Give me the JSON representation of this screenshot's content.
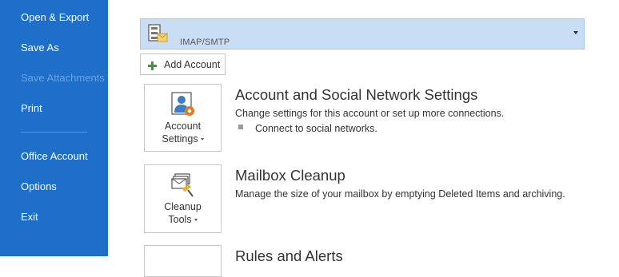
{
  "nav": {
    "items": [
      {
        "label": "Open & Export",
        "enabled": true
      },
      {
        "label": "Save As",
        "enabled": true
      },
      {
        "label": "Save Attachments",
        "enabled": false
      },
      {
        "label": "Print",
        "enabled": true
      },
      {
        "label": "Office Account",
        "enabled": true
      },
      {
        "label": "Options",
        "enabled": true
      },
      {
        "label": "Exit",
        "enabled": true
      }
    ]
  },
  "account_selector": {
    "selected": "IMAP/SMTP",
    "icon": "account-settings-icon"
  },
  "add_account": {
    "label": "Add Account",
    "icon": "plus-icon"
  },
  "sections": [
    {
      "tile_line1": "Account",
      "tile_line2": "Settings",
      "icon": "account-settings-icon",
      "title": "Account and Social Network Settings",
      "description": "Change settings for this account or set up more connections.",
      "bullets": [
        "Connect to social networks."
      ]
    },
    {
      "tile_line1": "Cleanup",
      "tile_line2": "Tools",
      "icon": "cleanup-tools-icon",
      "title": "Mailbox Cleanup",
      "description": "Manage the size of your mailbox by emptying Deleted Items and archiving.",
      "bullets": []
    },
    {
      "title": "Rules and Alerts",
      "icon": "rules-alerts-icon"
    }
  ],
  "colors": {
    "nav_background": "#1e6fc9",
    "selector_background": "#c9def5",
    "add_icon_green": "#3a9a3a",
    "gear_orange": "#e27a20"
  }
}
